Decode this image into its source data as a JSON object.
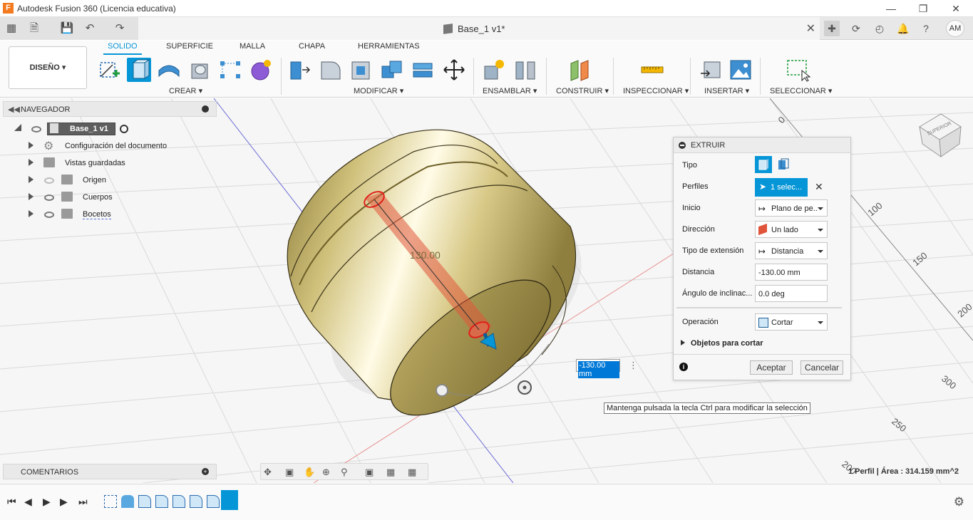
{
  "window": {
    "title": "Autodesk Fusion 360 (Licencia educativa)",
    "app_icon": "F"
  },
  "document": {
    "tab_title": "Base_1 v1*"
  },
  "user": {
    "initials": "AM"
  },
  "ribbon": {
    "workspace": "DISEÑO",
    "tabs": [
      "SOLIDO",
      "SUPERFICIE",
      "MALLA",
      "CHAPA",
      "HERRAMIENTAS"
    ],
    "active_tab": "SOLIDO",
    "groups": {
      "crear": "CREAR",
      "modificar": "MODIFICAR",
      "ensamblar": "ENSAMBLAR",
      "construir": "CONSTRUIR",
      "inspeccionar": "INSPECCIONAR",
      "insertar": "INSERTAR",
      "seleccionar": "SELECCIONAR"
    }
  },
  "navigator": {
    "title": "NAVEGADOR",
    "root": "Base_1 v1",
    "items": [
      {
        "label": "Configuración del documento",
        "icon": "gear-icon"
      },
      {
        "label": "Vistas guardadas",
        "icon": "folder-icon"
      },
      {
        "label": "Origen",
        "icon": "folder-icon",
        "visible": false
      },
      {
        "label": "Cuerpos",
        "icon": "folder-icon",
        "visible": true
      },
      {
        "label": "Bocetos",
        "icon": "folder-icon",
        "visible": true
      }
    ]
  },
  "comments": {
    "title": "COMENTARIOS"
  },
  "viewport": {
    "dimension_label": "130.00",
    "dimension_input": "-130.00 mm",
    "tooltip": "Mantenga pulsada la tecla Ctrl para modificar la selección",
    "status": "1 Perfil | Área : 314.159 mm^2",
    "view_cube_label": "SUPERIOR",
    "grid_labels": [
      "0",
      "100",
      "150",
      "200",
      "300",
      "250",
      "200"
    ]
  },
  "extrude_dialog": {
    "title": "EXTRUIR",
    "rows": {
      "tipo": "Tipo",
      "perfiles": "Perfiles",
      "perfiles_value": "1 selec...",
      "inicio": "Inicio",
      "inicio_value": "Plano de pe...",
      "direccion": "Dirección",
      "direccion_value": "Un lado",
      "tipo_extension": "Tipo de extensión",
      "tipo_extension_value": "Distancia",
      "distancia": "Distancia",
      "distancia_value": "-130.00 mm",
      "angulo": "Ángulo de inclinac...",
      "angulo_value": "0.0 deg",
      "operacion": "Operación",
      "operacion_value": "Cortar",
      "objetos": "Objetos para cortar"
    },
    "ok_label": "Aceptar",
    "cancel_label": "Cancelar"
  },
  "colors": {
    "accent": "#0696d7",
    "body_gold": "#c9b766",
    "cut_red": "#e0553a"
  }
}
